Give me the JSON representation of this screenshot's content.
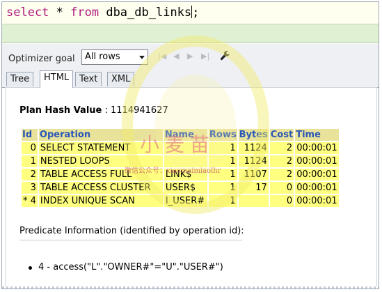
{
  "editor": {
    "keyword_select": "select",
    "star": " * ",
    "keyword_from": "from",
    "table_name": " dba_db_links",
    "terminator": ";"
  },
  "toolbar": {
    "optimizer_label": "Optimizer goal",
    "optimizer_value": "All rows",
    "nav_icons": [
      "first-icon",
      "previous-icon",
      "next-icon",
      "last-icon"
    ],
    "tool_icon": "wrench-icon"
  },
  "tabs": [
    "Tree",
    "HTML",
    "Text",
    "XML"
  ],
  "active_tab": "HTML",
  "plan": {
    "hash_label": "Plan Hash Value",
    "hash_sep": " : ",
    "hash_value": "1114941627",
    "columns": [
      "Id",
      "Operation",
      "Name",
      "Rows",
      "Bytes",
      "Cost",
      "Time"
    ],
    "rows": [
      {
        "id": "0",
        "operation": "SELECT STATEMENT",
        "name": "",
        "rows": "1",
        "bytes": "1124",
        "cost": "2",
        "time": "00:00:01"
      },
      {
        "id": "1",
        "operation": "NESTED LOOPS",
        "name": "",
        "rows": "1",
        "bytes": "1124",
        "cost": "2",
        "time": "00:00:01"
      },
      {
        "id": "2",
        "operation": "TABLE ACCESS FULL",
        "name": "LINK$",
        "rows": "1",
        "bytes": "1107",
        "cost": "2",
        "time": "00:00:01"
      },
      {
        "id": "3",
        "operation": "TABLE ACCESS CLUSTER",
        "name": "USER$",
        "rows": "1",
        "bytes": "17",
        "cost": "0",
        "time": "00:00:01"
      },
      {
        "id": "* 4",
        "operation": "INDEX UNIQUE SCAN",
        "name": "I_USER#",
        "rows": "1",
        "bytes": "",
        "cost": "0",
        "time": "00:00:01"
      }
    ]
  },
  "predicate": {
    "heading": "Predicate Information (identified by operation id):",
    "items": [
      "4 - access(\"L\".\"OWNER#\"=\"U\".\"USER#\")"
    ]
  },
  "watermark": {
    "brand": "小麦苗",
    "sub": "微信公众号：xiaomaimiaolhr"
  },
  "colors": {
    "keyword": "#b01a7e",
    "editor_bg": "#fffff0",
    "header_bg": "#e8e29a",
    "header_text": "#2a56b8",
    "cell_bg": "#ffff80"
  }
}
